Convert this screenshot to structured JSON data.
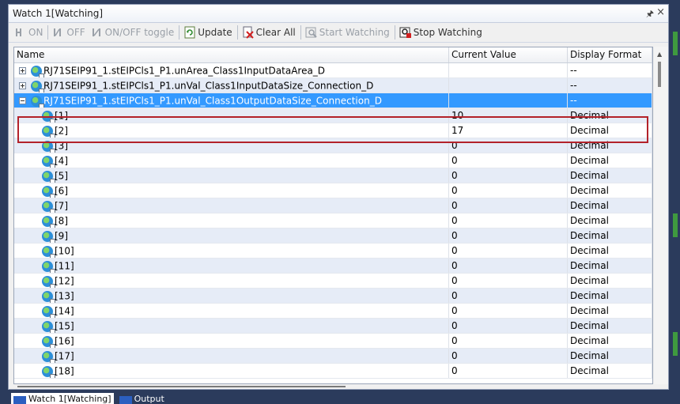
{
  "window": {
    "title": "Watch 1[Watching]"
  },
  "toolbar": {
    "on": "ON",
    "off": "OFF",
    "toggle": "ON/OFF toggle",
    "update": "Update",
    "clear_all": "Clear All",
    "start_watching": "Start Watching",
    "stop_watching": "Stop Watching"
  },
  "columns": {
    "name": "Name",
    "current_value": "Current Value",
    "display_format": "Display Format"
  },
  "rows": [
    {
      "name": "RJ71SEIP91_1.stEIPCls1_P1.unArea_Class1InputDataArea_D",
      "value": "",
      "format": "--"
    },
    {
      "name": "RJ71SEIP91_1.stEIPCls1_P1.unVal_Class1InputDataSize_Connection_D",
      "value": "",
      "format": "--"
    },
    {
      "name": "RJ71SEIP91_1.stEIPCls1_P1.unVal_Class1OutputDataSize_Connection_D",
      "value": "",
      "format": "--"
    },
    {
      "name": "[1]",
      "value": "10",
      "format": "Decimal"
    },
    {
      "name": "[2]",
      "value": "17",
      "format": "Decimal"
    },
    {
      "name": "[3]",
      "value": "0",
      "format": "Decimal"
    },
    {
      "name": "[4]",
      "value": "0",
      "format": "Decimal"
    },
    {
      "name": "[5]",
      "value": "0",
      "format": "Decimal"
    },
    {
      "name": "[6]",
      "value": "0",
      "format": "Decimal"
    },
    {
      "name": "[7]",
      "value": "0",
      "format": "Decimal"
    },
    {
      "name": "[8]",
      "value": "0",
      "format": "Decimal"
    },
    {
      "name": "[9]",
      "value": "0",
      "format": "Decimal"
    },
    {
      "name": "[10]",
      "value": "0",
      "format": "Decimal"
    },
    {
      "name": "[11]",
      "value": "0",
      "format": "Decimal"
    },
    {
      "name": "[12]",
      "value": "0",
      "format": "Decimal"
    },
    {
      "name": "[13]",
      "value": "0",
      "format": "Decimal"
    },
    {
      "name": "[14]",
      "value": "0",
      "format": "Decimal"
    },
    {
      "name": "[15]",
      "value": "0",
      "format": "Decimal"
    },
    {
      "name": "[16]",
      "value": "0",
      "format": "Decimal"
    },
    {
      "name": "[17]",
      "value": "0",
      "format": "Decimal"
    },
    {
      "name": "[18]",
      "value": "0",
      "format": "Decimal"
    }
  ],
  "tabs": [
    {
      "label": "Watch 1[Watching]"
    },
    {
      "label": "Output"
    }
  ],
  "colors": {
    "selection": "#3399ff",
    "highlight_box": "#b3222a",
    "alt_row": "#e6ecf7"
  }
}
